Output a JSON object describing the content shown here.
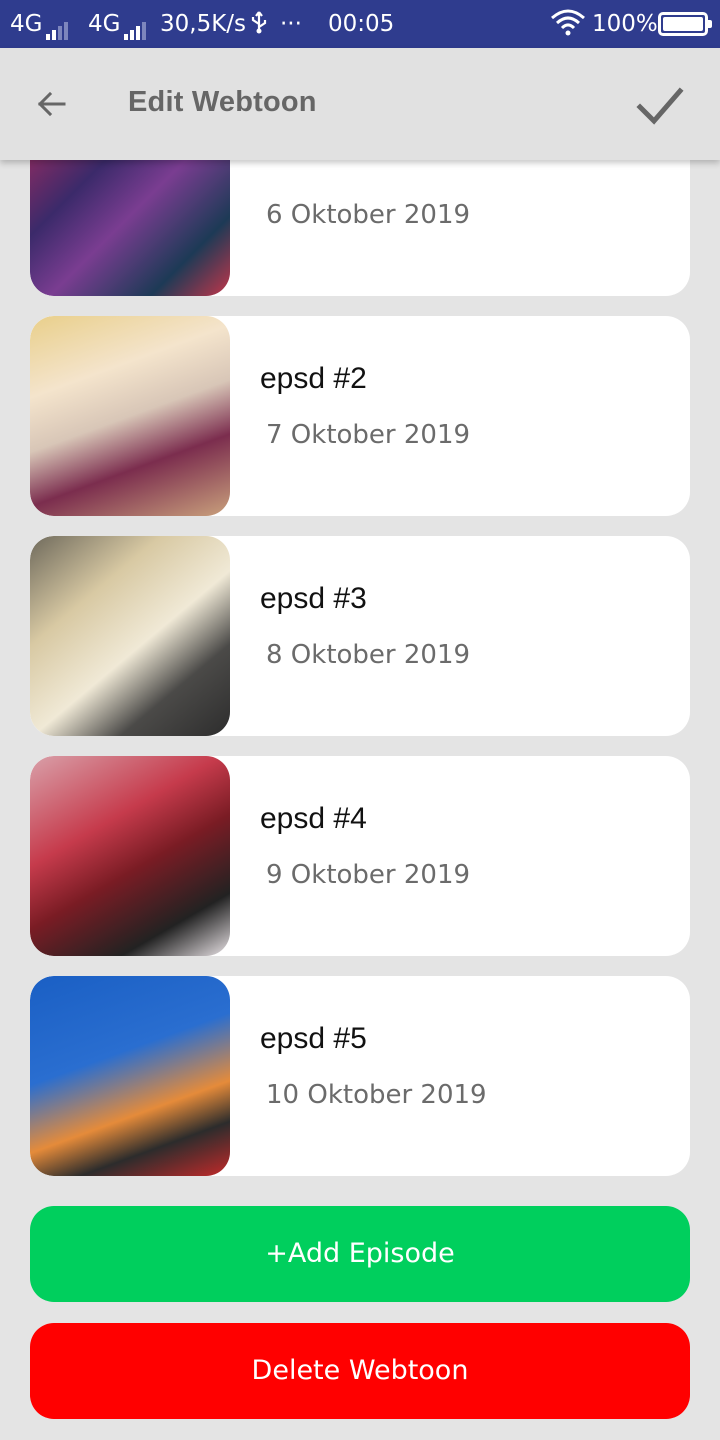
{
  "status_bar": {
    "network1": "4G",
    "network2": "4G",
    "speed": "30,5K/s",
    "usb_icon": "usb-icon",
    "more": "···",
    "time": "00:05",
    "battery": "100%"
  },
  "appbar": {
    "title": "Edit Webtoon",
    "back_icon": "arrow-left-icon",
    "confirm_icon": "check-icon"
  },
  "episodes": [
    {
      "title": "",
      "date": "6 Oktober 2019"
    },
    {
      "title": "epsd #2",
      "date": "7 Oktober 2019"
    },
    {
      "title": "epsd #3",
      "date": "8 Oktober 2019"
    },
    {
      "title": "epsd #4",
      "date": "9 Oktober 2019"
    },
    {
      "title": "epsd #5",
      "date": "10 Oktober 2019"
    }
  ],
  "buttons": {
    "add_label": "+Add Episode",
    "delete_label": "Delete Webtoon"
  },
  "colors": {
    "status_bar": "#2f3c8e",
    "add_button": "#00cf5d",
    "delete_button": "#ff0000"
  }
}
